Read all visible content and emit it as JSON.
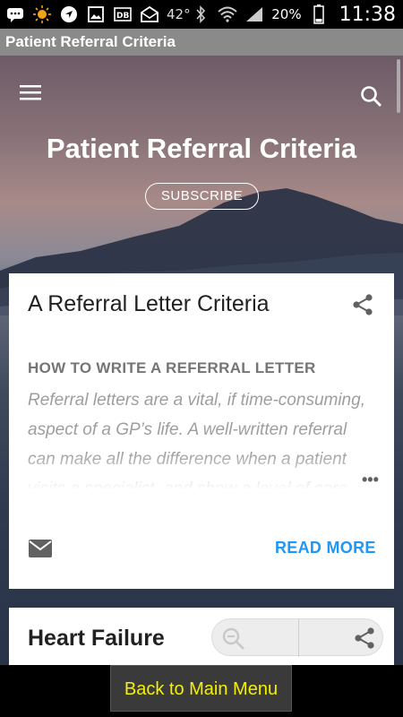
{
  "status_bar": {
    "icons": [
      "messages-icon",
      "weather-sun-icon",
      "navigation-icon",
      "gallery-icon",
      "data-icon",
      "mail-icon"
    ],
    "temperature": "42°",
    "battery_percent": "20%",
    "time": "11:38"
  },
  "app": {
    "title": "Patient Referral Criteria"
  },
  "hero": {
    "title": "Patient Referral Criteria",
    "subscribe_label": "SUBSCRIBE"
  },
  "posts": [
    {
      "title": "A Referral Letter Criteria",
      "subheading": "HOW TO WRITE A REFERRAL LETTER",
      "excerpt": "Referral letters are a vital, if time-consuming, aspect of a GP’s life. A well-written referral can make all the difference when a patient visits a specialist, and show a level of care",
      "read_more_label": "READ MORE"
    },
    {
      "title": "Heart Failure"
    }
  ],
  "bottom_bar": {
    "back_label": "Back to Main Menu"
  },
  "colors": {
    "accent": "#2196f3",
    "back_button_text": "#f5f000",
    "title_bar": "#8a8a8a"
  }
}
